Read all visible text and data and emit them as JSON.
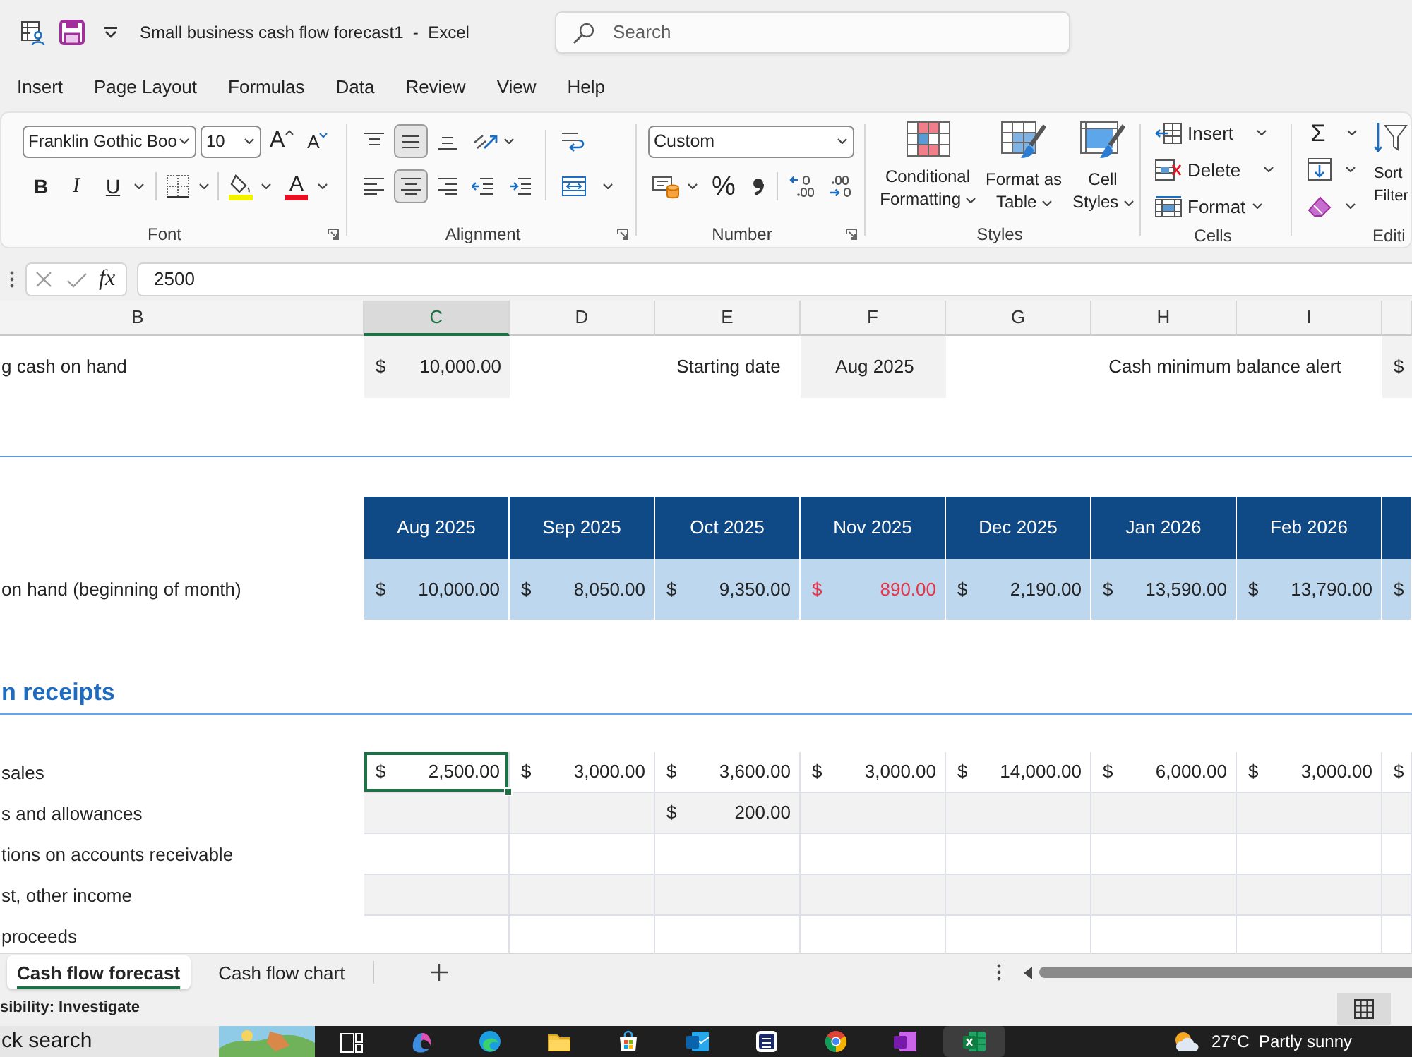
{
  "title_bar": {
    "title": "Small business cash flow forecast1  -  Excel",
    "search": {
      "placeholder": "Search"
    }
  },
  "menu": [
    {
      "label": "Insert"
    },
    {
      "label": "Page Layout"
    },
    {
      "label": "Formulas"
    },
    {
      "label": "Data"
    },
    {
      "label": "Review"
    },
    {
      "label": "View"
    },
    {
      "label": "Help"
    }
  ],
  "ribbon": {
    "font": {
      "font_name": "Franklin Gothic Boo",
      "font_size": "10",
      "grow": "A",
      "shrink": "A",
      "bold": "B",
      "italic": "I",
      "underline": "U",
      "font_color": "A",
      "label": "Font"
    },
    "alignment": {
      "buttons": [
        {
          "kind": "top",
          "selected": false
        },
        {
          "kind": "middle",
          "selected": true
        },
        {
          "kind": "bottom",
          "selected": false
        },
        {
          "kind": "left",
          "selected": false
        },
        {
          "kind": "center",
          "selected": true
        },
        {
          "kind": "right",
          "selected": false
        }
      ],
      "label": "Alignment"
    },
    "number": {
      "format": "Custom",
      "percent": "%",
      "label": "Number"
    },
    "styles": {
      "buttons": [
        {
          "kind": "conditional",
          "label": "Conditional Formatting"
        },
        {
          "kind": "table",
          "label": "Format as Table"
        },
        {
          "kind": "cell",
          "label": "Cell Styles"
        }
      ],
      "label": "Styles"
    },
    "cells": {
      "buttons": [
        {
          "kind": "insert",
          "label": "Insert"
        },
        {
          "kind": "delete",
          "label": "Delete"
        },
        {
          "kind": "format",
          "label": "Format"
        }
      ],
      "label": "Cells"
    },
    "editing": {
      "autosum": "Σ",
      "sort_filter": "Sort Filter",
      "label": "Editi"
    }
  },
  "formula_bar": {
    "fx": "fx",
    "value": "2500"
  },
  "columns": [
    {
      "label": "B",
      "selected": false
    },
    {
      "label": "C",
      "selected": true
    },
    {
      "label": "D",
      "selected": false
    },
    {
      "label": "E",
      "selected": false
    },
    {
      "label": "F",
      "selected": false
    },
    {
      "label": "G",
      "selected": false
    },
    {
      "label": "H",
      "selected": false
    },
    {
      "label": "I",
      "selected": false
    }
  ],
  "sheet": {
    "settings": {
      "cash_label": "g cash on hand",
      "cash_currency": "$",
      "cash_amount": "10,000.00",
      "date_label": "Starting date",
      "date_value": "Aug 2025",
      "alert_label": "Cash minimum balance alert",
      "alert_currency": "$"
    },
    "months": [
      "Aug 2025",
      "Sep 2025",
      "Oct 2025",
      "Nov 2025",
      "Dec 2025",
      "Jan 2026",
      "Feb 2026"
    ],
    "balance_row": {
      "label": "on hand (beginning of month)",
      "cells": [
        {
          "currency": "$",
          "amount": "10,000.00",
          "negative": false
        },
        {
          "currency": "$",
          "amount": "8,050.00",
          "negative": false
        },
        {
          "currency": "$",
          "amount": "9,350.00",
          "negative": false
        },
        {
          "currency": "$",
          "amount": "890.00",
          "negative": true
        },
        {
          "currency": "$",
          "amount": "2,190.00",
          "negative": false
        },
        {
          "currency": "$",
          "amount": "13,590.00",
          "negative": false
        },
        {
          "currency": "$",
          "amount": "13,790.00",
          "negative": false
        },
        {
          "currency": "$"
        }
      ]
    },
    "receipts": {
      "heading": "n receipts",
      "rows": [
        {
          "label": "sales",
          "cells": [
            {
              "currency": "$",
              "amount": "2,500.00",
              "selected": true
            },
            {
              "currency": "$",
              "amount": "3,000.00",
              "selected": false
            },
            {
              "currency": "$",
              "amount": "3,600.00",
              "selected": false
            },
            {
              "currency": "$",
              "amount": "3,000.00",
              "selected": false
            },
            {
              "currency": "$",
              "amount": "14,000.00",
              "selected": false
            },
            {
              "currency": "$",
              "amount": "6,000.00",
              "selected": false
            },
            {
              "currency": "$",
              "amount": "3,000.00",
              "selected": false
            },
            {
              "currency": "$",
              "selected": false
            }
          ]
        },
        {
          "label": "s and allowances",
          "cells": [
            {
              "selected": false
            },
            {
              "selected": false
            },
            {
              "currency": "$",
              "amount": "200.00",
              "selected": false
            },
            {
              "selected": false
            },
            {
              "selected": false
            },
            {
              "selected": false
            },
            {
              "selected": false
            },
            {
              "selected": false
            }
          ]
        },
        {
          "label": "tions on accounts receivable",
          "cells": [
            {
              "selected": false
            },
            {
              "selected": false
            },
            {
              "selected": false
            },
            {
              "selected": false
            },
            {
              "selected": false
            },
            {
              "selected": false
            },
            {
              "selected": false
            },
            {
              "selected": false
            }
          ]
        },
        {
          "label": "st, other income",
          "cells": [
            {
              "selected": false
            },
            {
              "selected": false
            },
            {
              "selected": false
            },
            {
              "selected": false
            },
            {
              "selected": false
            },
            {
              "selected": false
            },
            {
              "selected": false
            },
            {
              "selected": false
            }
          ]
        },
        {
          "label": "proceeds",
          "cells": [
            {
              "selected": false
            },
            {
              "selected": false
            },
            {
              "selected": false
            },
            {
              "selected": false
            },
            {
              "selected": false
            },
            {
              "selected": false
            },
            {
              "selected": false
            },
            {
              "selected": false
            }
          ]
        }
      ]
    }
  },
  "sheet_tabs": [
    {
      "label": "Cash flow forecast",
      "selected": true
    },
    {
      "label": "Cash flow chart",
      "selected": false
    }
  ],
  "status_bar": {
    "text": "sibility: Investigate"
  },
  "taskbar": {
    "search": {
      "placeholder": "ck search"
    },
    "apps": [
      {
        "kind": "task_view",
        "active": false
      },
      {
        "kind": "assistant",
        "active": false
      },
      {
        "kind": "browser",
        "active": false
      },
      {
        "kind": "folder",
        "active": false
      },
      {
        "kind": "store",
        "active": false
      },
      {
        "kind": "mail",
        "active": false
      },
      {
        "kind": "app",
        "active": false
      },
      {
        "kind": "web",
        "active": false
      },
      {
        "kind": "notebook",
        "active": false
      },
      {
        "kind": "spreadsheet",
        "active": true
      }
    ],
    "weather": "27°C  Partly sunny"
  }
}
